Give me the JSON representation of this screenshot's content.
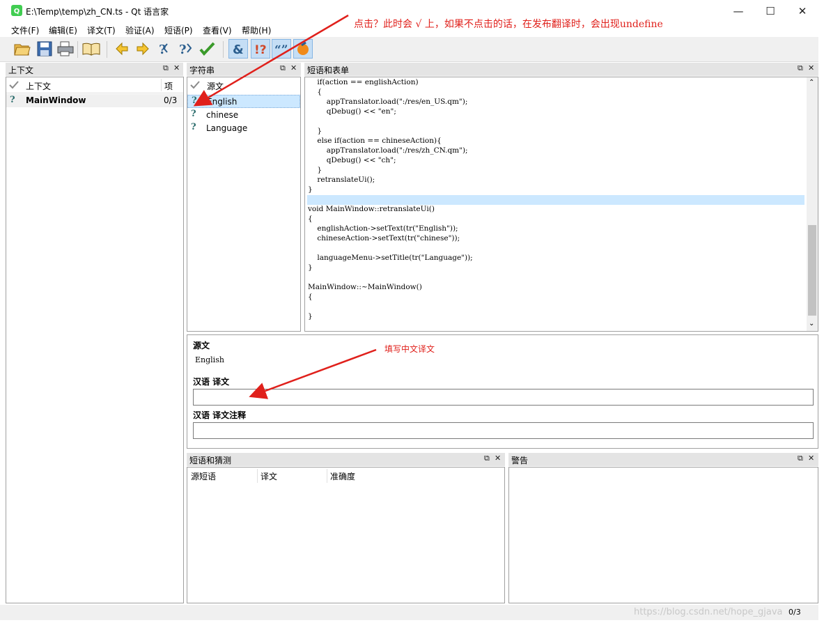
{
  "window": {
    "title": "E:\\Temp\\temp\\zh_CN.ts - Qt 语言家"
  },
  "menu": [
    "文件(F)",
    "编辑(E)",
    "译文(T)",
    "验证(A)",
    "短语(P)",
    "查看(V)",
    "帮助(H)"
  ],
  "toolbar": {
    "icons": [
      "open-folder-icon",
      "save-icon",
      "print-icon",
      "phrasebook-icon",
      "prev-icon",
      "next-icon",
      "prev-unfinished-icon",
      "next-unfinished-icon",
      "done-next-icon",
      "accelerator-check-icon",
      "punctuation-check-icon",
      "phrase-match-check-icon",
      "placeholder-check-icon"
    ]
  },
  "context_pane": {
    "title": "上下文",
    "col_source": "上下文",
    "col_items": "项",
    "rows": [
      {
        "name": "MainWindow",
        "count": "0/3"
      }
    ]
  },
  "strings_pane": {
    "title": "字符串",
    "header": "源文",
    "rows": [
      "English",
      "chinese",
      "Language"
    ]
  },
  "source_pane": {
    "title": "短语和表单",
    "code": [
      "    if(action == englishAction)",
      "    {",
      "        appTranslator.load(\":/res/en_US.qm\");",
      "        qDebug() << \"en\";",
      "",
      "    }",
      "    else if(action == chineseAction){",
      "        appTranslator.load(\":/res/zh_CN.qm\");",
      "        qDebug() << \"ch\";",
      "    }",
      "    retranslateUi();",
      "}",
      "",
      "void MainWindow::retranslateUi()",
      "{",
      "    englishAction->setText(tr(\"English\"));",
      "    chineseAction->setText(tr(\"chinese\"));",
      "",
      "    languageMenu->setTitle(tr(\"Language\"));",
      "}",
      "",
      "MainWindow::~MainWindow()",
      "{",
      "",
      "}"
    ]
  },
  "editor": {
    "source_label": "源文",
    "source_text": "English",
    "translation_label": "汉语 译文",
    "translation_value": "",
    "comment_label": "汉语 译文注释",
    "comment_value": ""
  },
  "phrases_pane": {
    "title": "短语和猜测",
    "cols": [
      "源短语",
      "译文",
      "准确度"
    ]
  },
  "warnings_pane": {
    "title": "警告"
  },
  "status": {
    "count": "0/3",
    "watermark": "https://blog.csdn.net/hope_gjava"
  },
  "annotations": {
    "top": "点击？此时会 √ 上，如果不点击的话，在发布翻译时，会出现undefine",
    "middle": "填写中文译文"
  },
  "colors": {
    "highlight": "#cce8ff",
    "annotation_red": "#e0201b",
    "pane_header": "#e4e4e4"
  }
}
